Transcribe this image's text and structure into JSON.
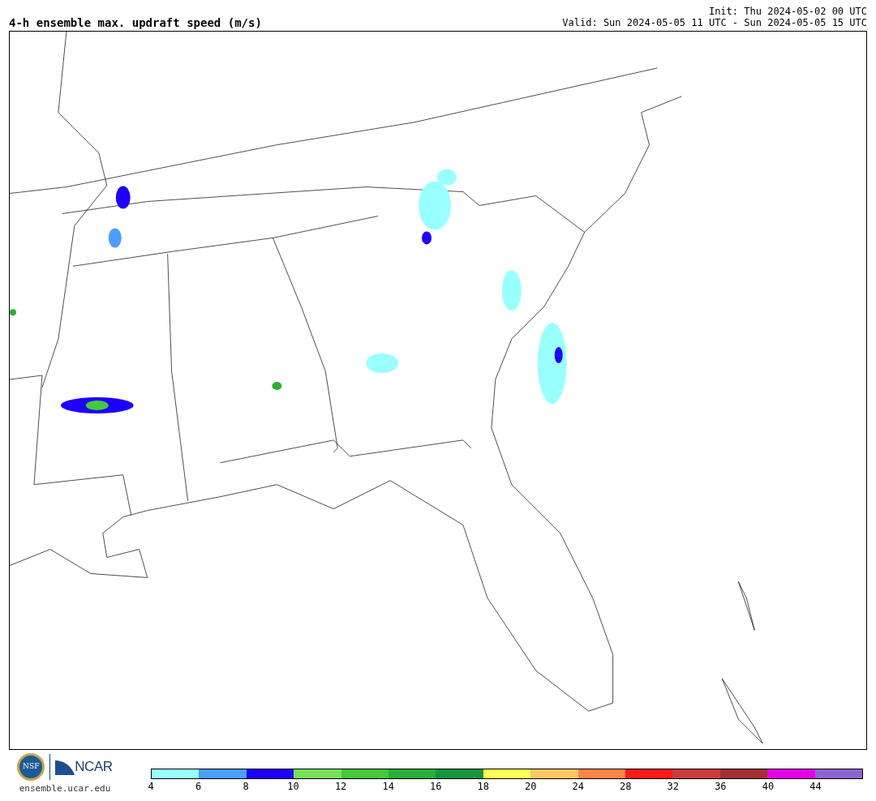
{
  "title": "4-h ensemble max. updraft speed (m/s)",
  "init": "Init: Thu 2024-05-02 00 UTC",
  "valid": "Valid: Sun 2024-05-05 11 UTC - Sun 2024-05-05 15 UTC",
  "logos": {
    "nsf": "NSF",
    "ncar": "NCAR"
  },
  "site": "ensemble.ucar.edu",
  "colorbar": {
    "bins": [
      {
        "color": "#99ffff"
      },
      {
        "color": "#4c9eff"
      },
      {
        "color": "#1e00ff"
      },
      {
        "color": "#76e05a"
      },
      {
        "color": "#46c83c"
      },
      {
        "color": "#2aae38"
      },
      {
        "color": "#17943c"
      },
      {
        "color": "#ffff55"
      },
      {
        "color": "#ffc863"
      },
      {
        "color": "#ff8547"
      },
      {
        "color": "#ff1a1a"
      },
      {
        "color": "#cc3c3c"
      },
      {
        "color": "#a33030"
      },
      {
        "color": "#e600e6"
      },
      {
        "color": "#8c64d2"
      }
    ],
    "ticks": [
      "4",
      "6",
      "8",
      "10",
      "12",
      "14",
      "16",
      "18",
      "20",
      "24",
      "28",
      "32",
      "36",
      "40",
      "44"
    ]
  }
}
